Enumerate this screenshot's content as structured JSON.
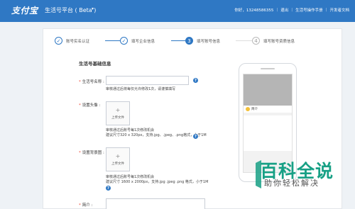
{
  "header": {
    "logo": "支付宝",
    "platform": "生活号平台 ( Beta )",
    "caret": "▾",
    "greeting": "你好，13248586355",
    "logout": "退出",
    "manual": "生活号操作手册",
    "dev_docs": "开发者文档",
    "bg_color": "#2f78c4"
  },
  "steps": [
    {
      "label": "账号实名认证",
      "status": "done",
      "icon": "check-icon"
    },
    {
      "label": "填写企业信息",
      "status": "done",
      "icon": "check-icon"
    },
    {
      "label": "填写账号信息",
      "status": "active",
      "number": "3"
    },
    {
      "label": "填写账号资质信息",
      "status": "todo",
      "number": "4"
    }
  ],
  "form": {
    "section_title": "生活号基础信息",
    "name": {
      "label": "生活号名称 :",
      "hint": "审核通过后将每仅允许修改1次，请谨慎填写"
    },
    "avatar": {
      "label": "设置头像 :",
      "upload": "上传文件",
      "hint1": "审核通过后账号每1次修改机会",
      "hint2": "建议尺寸320 x 320px，支持.jpg、.jpeg、.png格式，小于1M"
    },
    "cover": {
      "label": "设置背景图 :",
      "upload": "上传文件",
      "hint1": "审核通过后账号每1次修改机会",
      "hint2": "建议尺寸 1600 x 2000px，支持.jpg .jpeg .png 格式，小于1M"
    },
    "intro": {
      "label": "简介 :"
    }
  },
  "preview": {
    "name": "简介"
  },
  "watermark": {
    "title": "百科全说",
    "subtitle": "助你轻松解决",
    "color": "#17a085"
  }
}
